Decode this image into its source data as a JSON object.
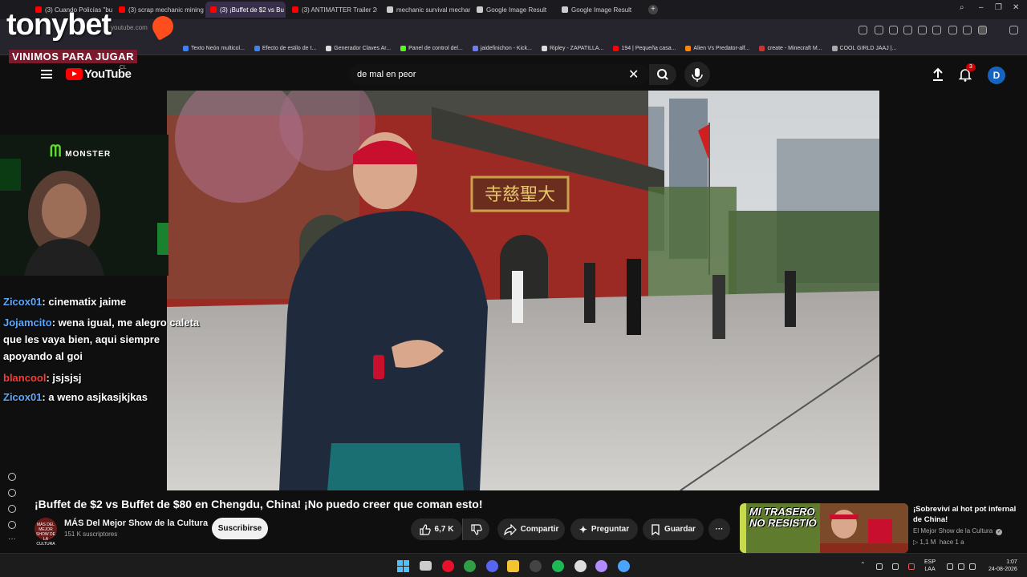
{
  "browser": {
    "tabs": [
      {
        "label": "(3) Cuando Policías \"buen",
        "color": "#ff0000",
        "active": false
      },
      {
        "label": "(3) scrap mechanic mining",
        "color": "#ff0000",
        "active": false
      },
      {
        "label": "(3) ¡Buffet de $2 vs Bu",
        "color": "#ff0000",
        "active": true
      },
      {
        "label": "(3) ANTIMATTER Trailer 20",
        "color": "#ff0000",
        "active": false
      },
      {
        "label": "mechanic survival mechan",
        "color": "#cccccc",
        "active": false
      },
      {
        "label": "Google Image Result",
        "color": "#cccccc",
        "active": false
      },
      {
        "label": "Google Image Result",
        "color": "#cccccc",
        "active": false
      }
    ],
    "new_tab": "+",
    "url_fragment": "youtube.com",
    "bookmarks": [
      {
        "label": "Texto Neón multicol...",
        "color": "#3b82f6"
      },
      {
        "label": "Efecto de estilo de t...",
        "color": "#3b82f6"
      },
      {
        "label": "Generador Claves Ar...",
        "color": "#dddddd"
      },
      {
        "label": "Panel de control del...",
        "color": "#53fc18"
      },
      {
        "label": "jaidefinichon - Kick...",
        "color": "#6b7cff"
      },
      {
        "label": "Ripley - ZAPATILLA...",
        "color": "#dddddd"
      },
      {
        "label": "194 | Pequeña casa...",
        "color": "#ff0000"
      },
      {
        "label": "Alien Vs Predator-alf...",
        "color": "#ff8800"
      },
      {
        "label": "create - Minecraft M...",
        "color": "#cc3333"
      },
      {
        "label": "COOL GIRLD JAAJ |...",
        "color": "#aaaaaa"
      }
    ]
  },
  "overlay": {
    "logo": "tonybet",
    "slogan": "VINIMOS PARA JUGAR",
    "sponsor": "MONSTER"
  },
  "youtube": {
    "wordmark": "YouTube",
    "country": "CL",
    "search_value": "de mal en peor",
    "notification_count": "3",
    "avatar_letter": "D"
  },
  "chat": [
    {
      "user": "Zicox01",
      "user_color": "#5aa9ff",
      "text": ": cinematix jaime"
    },
    {
      "user": "Jojamcito",
      "user_color": "#5aa9ff",
      "text": ": wena igual, me alegro caleta que les vaya bien, aqui siempre apoyando al goi"
    },
    {
      "user": "blancool",
      "user_color": "#ff3b3b",
      "text": ": jsjsjsj"
    },
    {
      "user": "Zicox01",
      "user_color": "#5aa9ff",
      "text": ": a weno asjkasjkjkas"
    }
  ],
  "video": {
    "title": "¡Buffet de $2 vs Buffet de $80 en Chengdu, China! ¡No puedo creer que coman esto!",
    "channel": "MÁS Del Mejor Show de la Cultura",
    "channel_avatar_text": "MÁS DEL MEJOR SHOW DE LA CULTURA",
    "subscribers": "151 K suscriptores",
    "subscribe": "Suscribirse",
    "likes": "6,7 K",
    "share": "Compartir",
    "ask": "Preguntar",
    "save": "Guardar",
    "more": "···",
    "sign_text": "寺慈聖大"
  },
  "recommended": {
    "title": "¡Sobreviví al hot pot infernal de China!",
    "channel": "El Mejor Show de la Cultura",
    "views": "1,1 M",
    "age": "hace 1 a",
    "thumb_text": "MI TRASERO NO RESISTIÓ"
  },
  "taskbar": {
    "lang_top": "ESP",
    "lang_bottom": "LAA",
    "time": "1:07",
    "date": "24-08-2026"
  }
}
